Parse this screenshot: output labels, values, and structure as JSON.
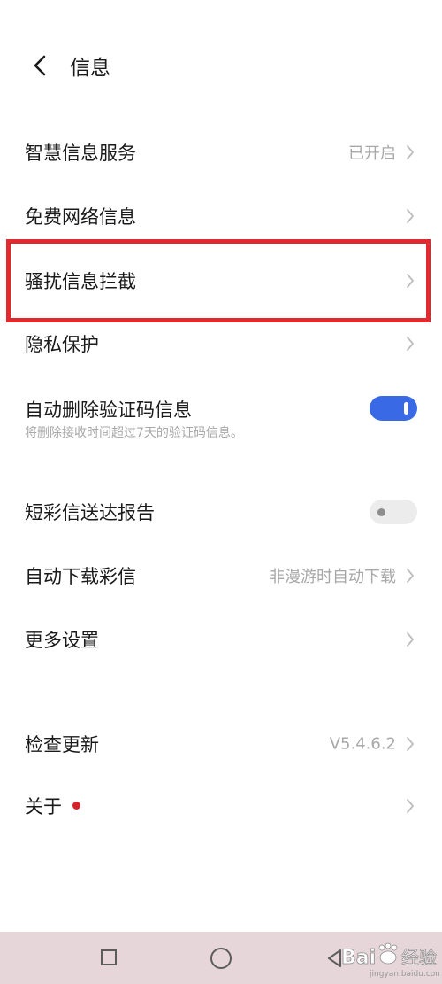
{
  "header": {
    "back_icon": "chevron-left-icon",
    "title": "信息"
  },
  "rows": [
    {
      "label": "智慧信息服务",
      "value": "已开启",
      "trailing": "chevron-right-icon"
    },
    {
      "label": "免费网络信息",
      "trailing": "chevron-right-icon"
    },
    {
      "label": "骚扰信息拦截",
      "trailing": "chevron-right-icon",
      "highlighted": true,
      "highlight_color": "#e12a30"
    },
    {
      "label": "隐私保护",
      "trailing": "chevron-right-icon"
    },
    {
      "label": "自动删除验证码信息",
      "subtitle": "将删除接收时间超过7天的验证码信息。",
      "toggle": "on",
      "toggle_color": "#3a69e6"
    },
    {
      "label": "短彩信送达报告",
      "toggle": "off"
    },
    {
      "label": "自动下载彩信",
      "value": "非漫游时自动下载",
      "trailing": "chevron-right-icon"
    },
    {
      "label": "更多设置",
      "trailing": "chevron-right-icon"
    },
    {
      "label": "检查更新",
      "value": "V5.4.6.2",
      "trailing": "chevron-right-icon"
    },
    {
      "label": "关于",
      "badge": "red-dot",
      "badge_color": "#d3232b",
      "trailing": "chevron-right-icon"
    }
  ],
  "navbar": {
    "background": "#e6d6da",
    "recent_icon": "square-icon",
    "home_icon": "circle-icon",
    "back_icon": "triangle-back-icon"
  },
  "watermark": {
    "logo": "Baidu",
    "text": "经验",
    "subtext": "jingyan.baidu.com"
  }
}
